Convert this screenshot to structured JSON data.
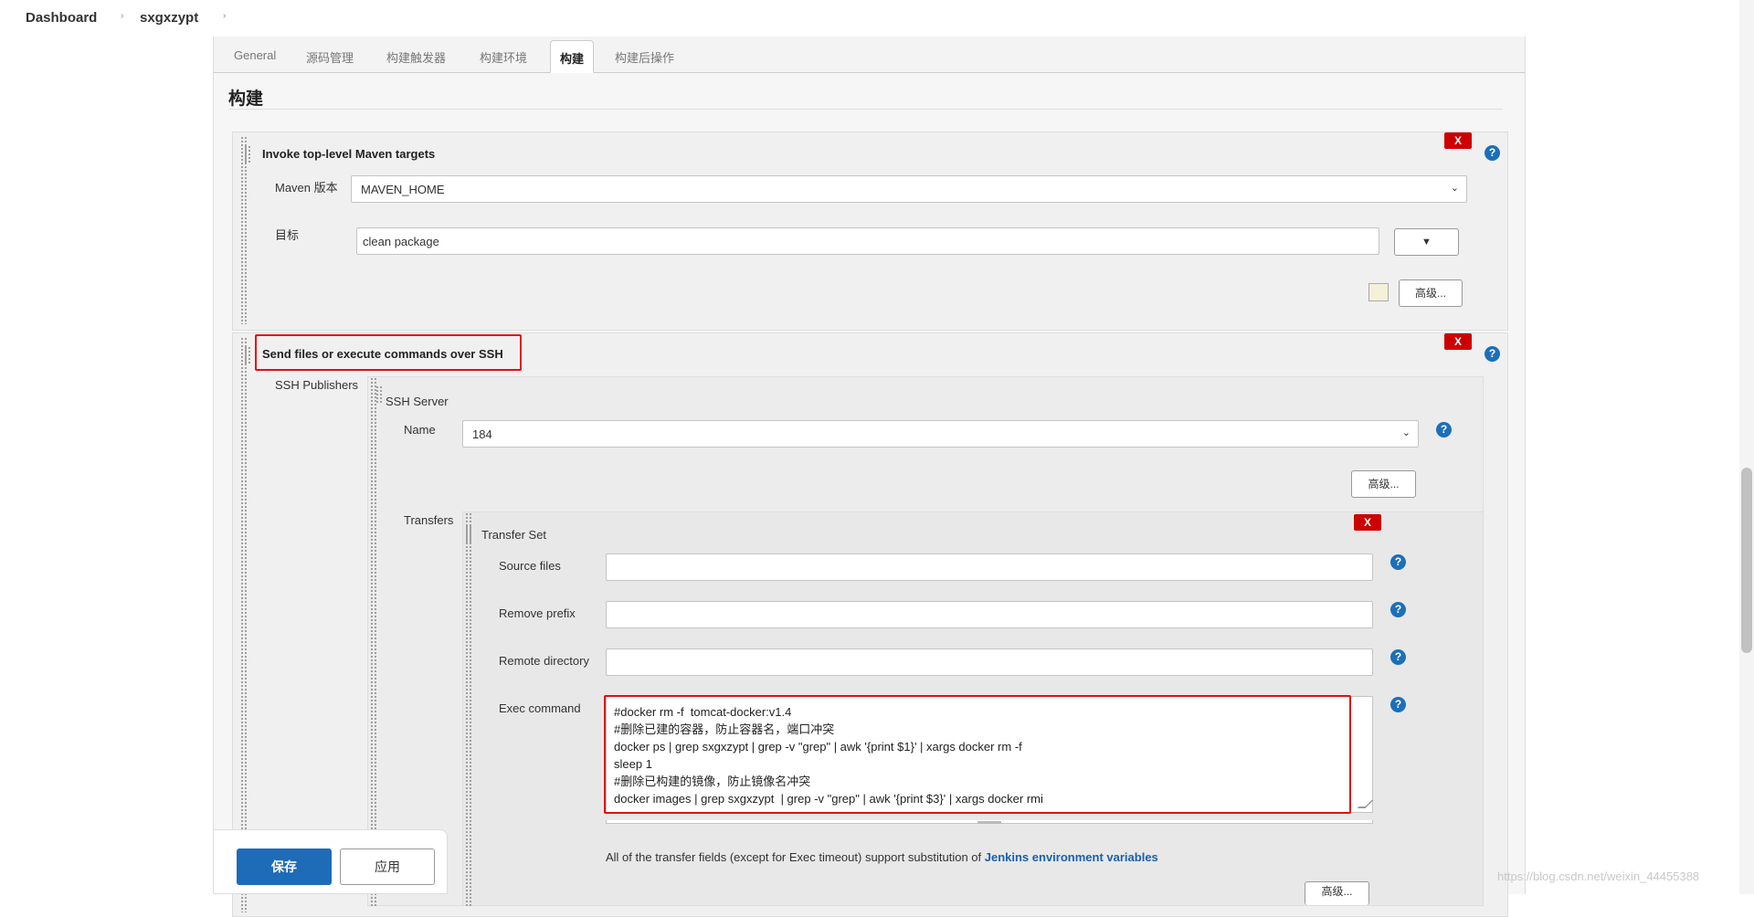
{
  "breadcrumb": {
    "dashboard": "Dashboard",
    "sep": "›",
    "project": "sxgxzypt"
  },
  "tabs": [
    "General",
    "源码管理",
    "构建触发器",
    "构建环境",
    "构建",
    "构建后操作"
  ],
  "section": {
    "title": "构建"
  },
  "maven": {
    "title": "Invoke top-level Maven targets",
    "version_label": "Maven 版本",
    "version_value": "MAVEN_HOME",
    "goals_label": "目标",
    "goals_value": "clean package",
    "advanced_label": "高级..."
  },
  "ssh": {
    "title": "Send files or execute commands over SSH",
    "publishers_label": "SSH Publishers",
    "server_label": "SSH Server",
    "name_label": "Name",
    "name_value": "184",
    "advanced_label": "高级...",
    "transfers_label": "Transfers",
    "transfer_set_label": "Transfer Set",
    "source_files_label": "Source files",
    "source_files_value": "",
    "remove_prefix_label": "Remove prefix",
    "remove_prefix_value": "",
    "remote_directory_label": "Remote directory",
    "remote_directory_value": "",
    "exec_command_label": "Exec command",
    "exec_command_value": "#docker rm -f  tomcat-docker:v1.4\n#删除已建的容器，防止容器名，端口冲突\ndocker ps | grep sxgxzypt | grep -v \"grep\" | awk '{print $1}' | xargs docker rm -f\nsleep 1\n#删除已构建的镜像，防止镜像名冲突\ndocker images | grep sxgxzypt  | grep -v \"grep\" | awk '{print $3}' | xargs docker rmi",
    "note_prefix": "All of the transfer fields (except for Exec timeout) support substitution of ",
    "note_link": "Jenkins environment variables",
    "bottom_advanced_label": "高级..."
  },
  "delete_label": "X",
  "help_label": "?",
  "select_chevron": "⌄",
  "dropdown_arrow": "▼",
  "actions": {
    "save": "保存",
    "apply": "应用"
  },
  "watermark": "https://blog.csdn.net/weixin_44455388",
  "colors": {
    "primary": "#1e6bb8",
    "delete": "#cc0000",
    "highlight": "#e01010",
    "help": "#1c6fb8"
  }
}
